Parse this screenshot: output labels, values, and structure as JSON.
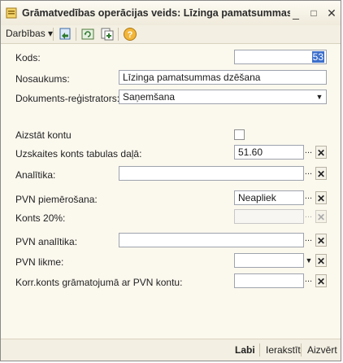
{
  "window": {
    "title": "Grāmatvedības operācijas veids: Līzinga pamatsummas d...",
    "buttons": {
      "minimize": "_",
      "maximize": "□",
      "close": "✕"
    }
  },
  "toolbar": {
    "actions_menu": "Darbības ▾",
    "icons": [
      "save-and-close-icon",
      "refresh-icon",
      "copy-new-icon",
      "help-icon"
    ]
  },
  "form": {
    "kods": {
      "label": "Kods:",
      "value": "53"
    },
    "nosaukums": {
      "label": "Nosaukums:",
      "value": "Līzinga pamatsummas dzēšana"
    },
    "dok_registrators": {
      "label": "Dokuments-reģistrators:",
      "value": "Saņemšana"
    },
    "aizstat_kontu": {
      "label": "Aizstāt kontu",
      "checked": false
    },
    "uzskaites_konts": {
      "label": "Uzskaites konts tabulas daļā:",
      "value": "51.60"
    },
    "analitika": {
      "label": "Analītika:",
      "value": ""
    },
    "pvn_piemerosana": {
      "label": "PVN piemērošana:",
      "value": "Neapliek"
    },
    "konts20": {
      "label": "Konts 20%:",
      "value": ""
    },
    "pvn_analitika": {
      "label": "PVN analītika:",
      "value": ""
    },
    "pvn_likme": {
      "label": "PVN likme:",
      "value": ""
    },
    "korr_konts": {
      "label": "Korr.konts grāmatojumā ar PVN kontu:",
      "value": ""
    }
  },
  "buttons": {
    "select": "...",
    "clear": "✕",
    "dropdown": "▼"
  },
  "footer": {
    "ok": "Labi",
    "save": "Ierakstīt",
    "close": "Aizvērt"
  },
  "colors": {
    "background": "#fbf8ee",
    "selection": "#3c6fcb"
  }
}
